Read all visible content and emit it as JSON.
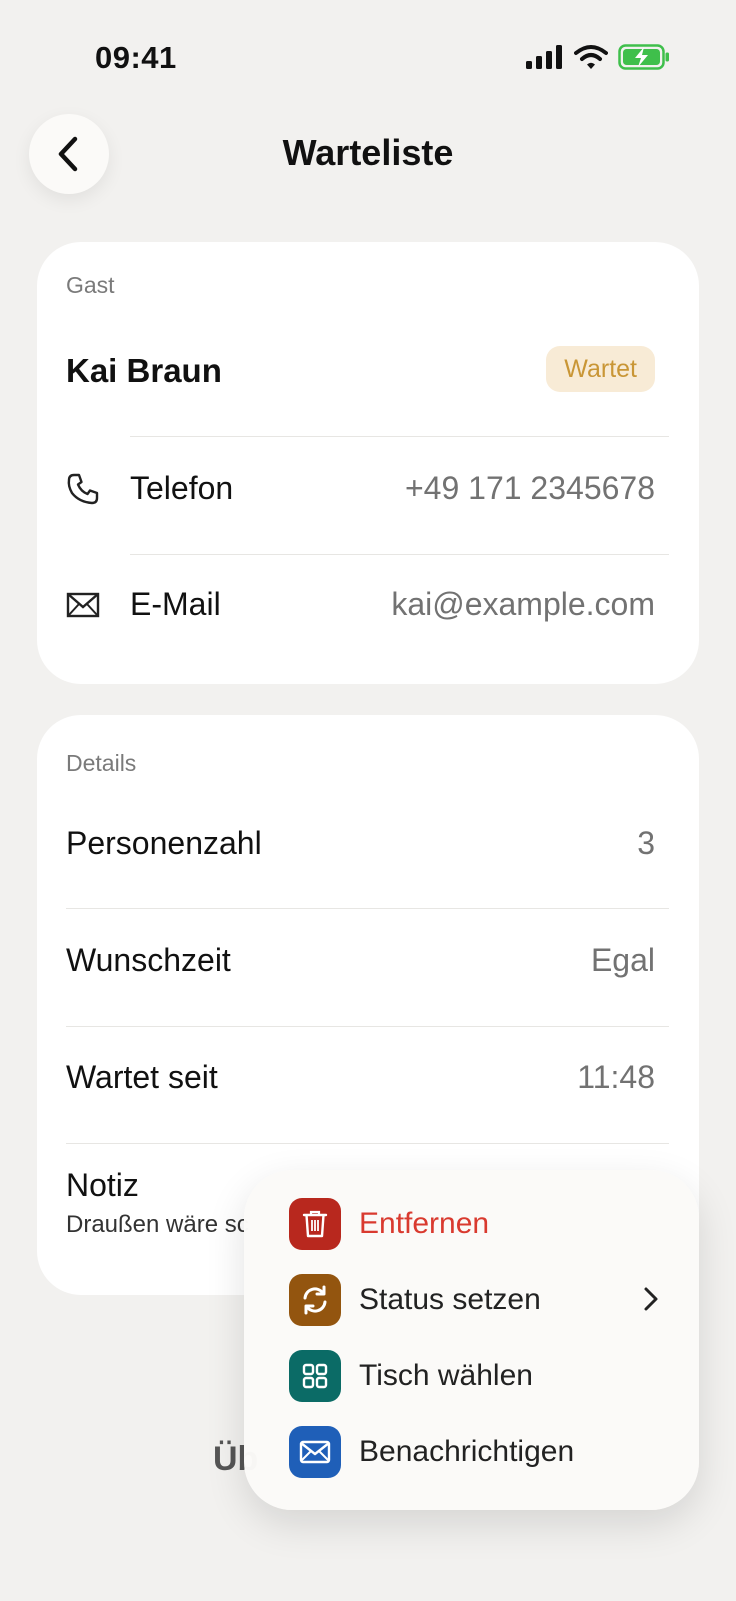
{
  "status_bar": {
    "time": "09:41"
  },
  "nav": {
    "title": "Warteliste"
  },
  "guest": {
    "section_label": "Gast",
    "name": "Kai Braun",
    "status": "Wartet",
    "phone_label": "Telefon",
    "phone_value": "+49 171 2345678",
    "email_label": "E-Mail",
    "email_value": "kai@example.com"
  },
  "details": {
    "section_label": "Details",
    "party_label": "Personenzahl",
    "party_value": "3",
    "time_label": "Wunschzeit",
    "time_value": "Egal",
    "waiting_label": "Wartet seit",
    "waiting_value": "11:48",
    "note_label": "Notiz",
    "note_text": "Draußen wäre sc"
  },
  "bottom": {
    "partial_text": "Üb"
  },
  "menu": {
    "items": [
      {
        "label": "Entfernen",
        "icon": "trash-icon",
        "color": "#b8281e",
        "text_color": "#d93a2f"
      },
      {
        "label": "Status setzen",
        "icon": "cycle-icon",
        "color": "#93550f",
        "text_color": "#222222"
      },
      {
        "label": "Tisch wählen",
        "icon": "grid-icon",
        "color": "#0b6b66",
        "text_color": "#222222"
      },
      {
        "label": "Benachrichtigen",
        "icon": "envelope-icon",
        "color": "#1f5fb8",
        "text_color": "#222222"
      }
    ]
  }
}
